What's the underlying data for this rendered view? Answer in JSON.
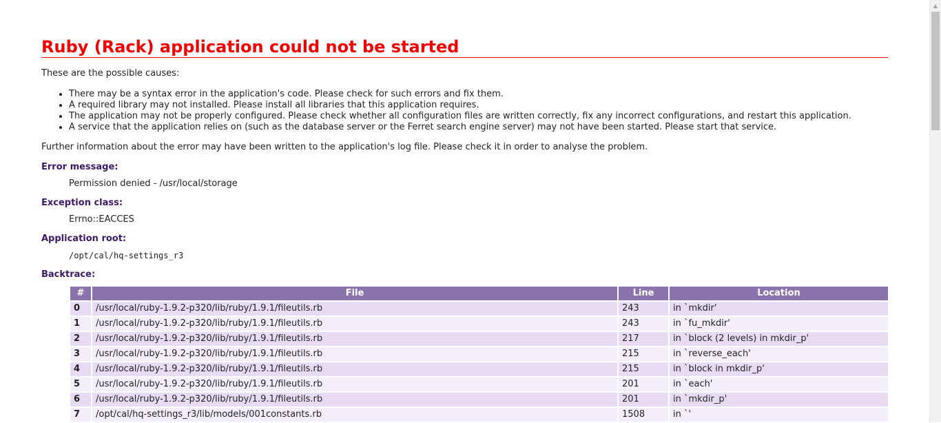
{
  "page": {
    "title": "Ruby (Rack) application could not be started",
    "intro": "These are the possible causes:",
    "causes": [
      "There may be a syntax error in the application's code. Please check for such errors and fix them.",
      "A required library may not installed. Please install all libraries that this application requires.",
      "The application may not be properly configured. Please check whether all configuration files are written correctly, fix any incorrect configurations, and restart this application.",
      "A service that the application relies on (such as the database server or the Ferret search engine server) may not have been started. Please start that service."
    ],
    "further": "Further information about the error may have been written to the application's log file. Please check it in order to analyse the problem."
  },
  "error": {
    "message_label": "Error message:",
    "message": "Permission denied - /usr/local/storage",
    "class_label": "Exception class:",
    "class": "Errno::EACCES",
    "root_label": "Application root:",
    "root": "/opt/cal/hq-settings_r3"
  },
  "backtrace": {
    "label": "Backtrace:",
    "headers": {
      "num": "#",
      "file": "File",
      "line": "Line",
      "location": "Location"
    },
    "rows": [
      {
        "num": "0",
        "file": "/usr/local/ruby-1.9.2-p320/lib/ruby/1.9.1/fileutils.rb",
        "line": "243",
        "location": "in `mkdir'"
      },
      {
        "num": "1",
        "file": "/usr/local/ruby-1.9.2-p320/lib/ruby/1.9.1/fileutils.rb",
        "line": "243",
        "location": "in `fu_mkdir'"
      },
      {
        "num": "2",
        "file": "/usr/local/ruby-1.9.2-p320/lib/ruby/1.9.1/fileutils.rb",
        "line": "217",
        "location": "in `block (2 levels) in mkdir_p'"
      },
      {
        "num": "3",
        "file": "/usr/local/ruby-1.9.2-p320/lib/ruby/1.9.1/fileutils.rb",
        "line": "215",
        "location": "in `reverse_each'"
      },
      {
        "num": "4",
        "file": "/usr/local/ruby-1.9.2-p320/lib/ruby/1.9.1/fileutils.rb",
        "line": "215",
        "location": "in `block in mkdir_p'"
      },
      {
        "num": "5",
        "file": "/usr/local/ruby-1.9.2-p320/lib/ruby/1.9.1/fileutils.rb",
        "line": "201",
        "location": "in `each'"
      },
      {
        "num": "6",
        "file": "/usr/local/ruby-1.9.2-p320/lib/ruby/1.9.1/fileutils.rb",
        "line": "201",
        "location": "in `mkdir_p'"
      },
      {
        "num": "7",
        "file": "/opt/cal/hq-settings_r3/lib/models/001constants.rb",
        "line": "1508",
        "location": "in `'"
      }
    ]
  },
  "colors": {
    "title": "#ee0000",
    "label": "#3b1a64",
    "table_header": "#8b74ab",
    "row_even": "#e8dcf5",
    "row_odd": "#f3eefa"
  },
  "icons": {
    "scroll_up": "chevron-up-icon"
  }
}
